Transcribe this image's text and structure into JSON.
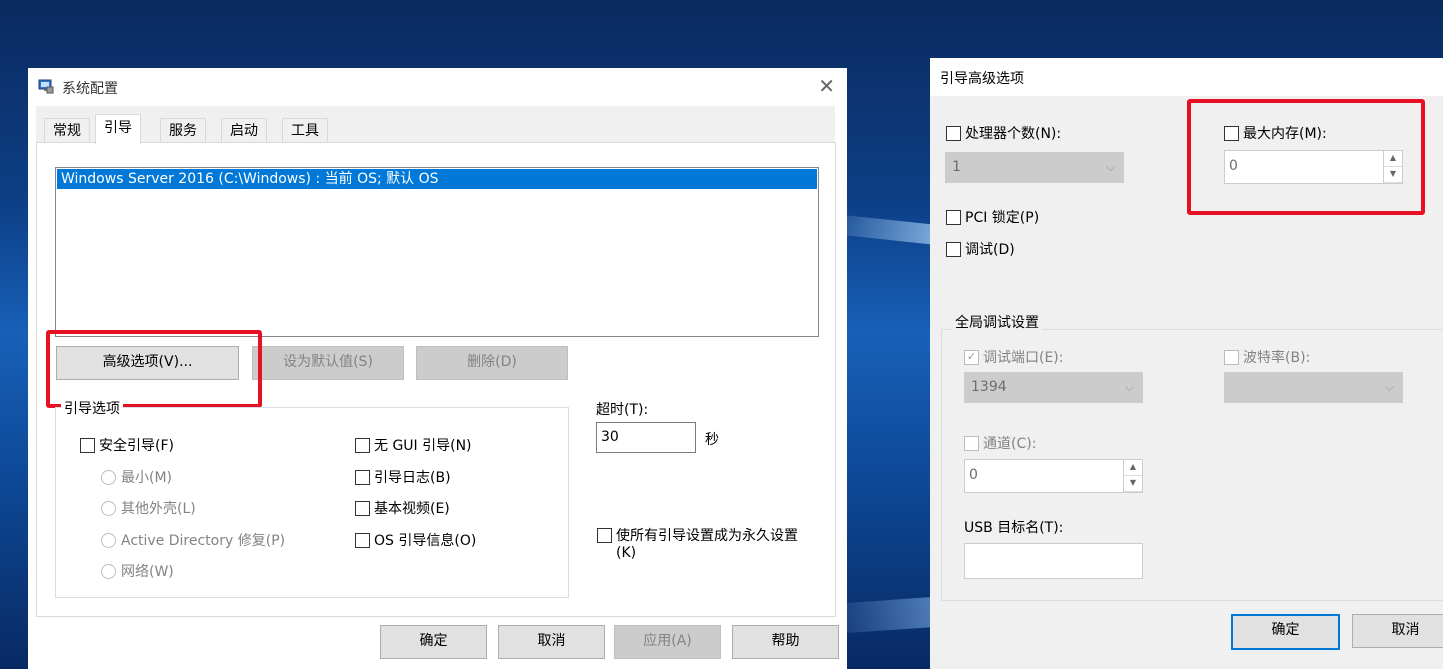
{
  "sysconfig": {
    "title": "系统配置",
    "close_glyph": "✕",
    "tabs": [
      {
        "label": "常规"
      },
      {
        "label": "引导"
      },
      {
        "label": "服务"
      },
      {
        "label": "启动"
      },
      {
        "label": "工具"
      }
    ],
    "os_entry": "Windows Server 2016 (C:\\Windows) : 当前 OS; 默认 OS",
    "buttons": {
      "advanced": "高级选项(V)...",
      "set_default": "设为默认值(S)",
      "delete": "删除(D)"
    },
    "boot_options": {
      "group_label": "引导选项",
      "safe_boot": "安全引导(F)",
      "minimal": "最小(M)",
      "alternate_shell": "其他外壳(L)",
      "ad_repair": "Active Directory 修复(P)",
      "network": "网络(W)",
      "no_gui": "无 GUI 引导(N)",
      "boot_log": "引导日志(B)",
      "base_video": "基本视频(E)",
      "os_boot_info": "OS 引导信息(O)"
    },
    "timeout": {
      "label": "超时(T):",
      "value": "30",
      "unit": "秒"
    },
    "make_permanent": {
      "line1": "使所有引导设置成为永久设置",
      "line2": "(K)"
    },
    "footer": {
      "ok": "确定",
      "cancel": "取消",
      "apply": "应用(A)",
      "help": "帮助"
    }
  },
  "advanced": {
    "title": "引导高级选项",
    "num_processors": {
      "label": "处理器个数(N):",
      "value": "1"
    },
    "max_memory": {
      "label": "最大内存(M):",
      "value": "0"
    },
    "pci_lock": "PCI 锁定(P)",
    "debug": "调试(D)",
    "global_debug": {
      "group_label": "全局调试设置",
      "debug_port": {
        "label": "调试端口(E):",
        "value": "1394"
      },
      "baud_rate": {
        "label": "波特率(B):",
        "value": ""
      },
      "channel": {
        "label": "通道(C):",
        "value": "0"
      },
      "usb_target": {
        "label": "USB 目标名(T):",
        "value": ""
      }
    },
    "footer": {
      "ok": "确定",
      "cancel": "取消"
    }
  },
  "colors": {
    "highlight": "#0078d7",
    "annotation_red": "#e81123"
  }
}
